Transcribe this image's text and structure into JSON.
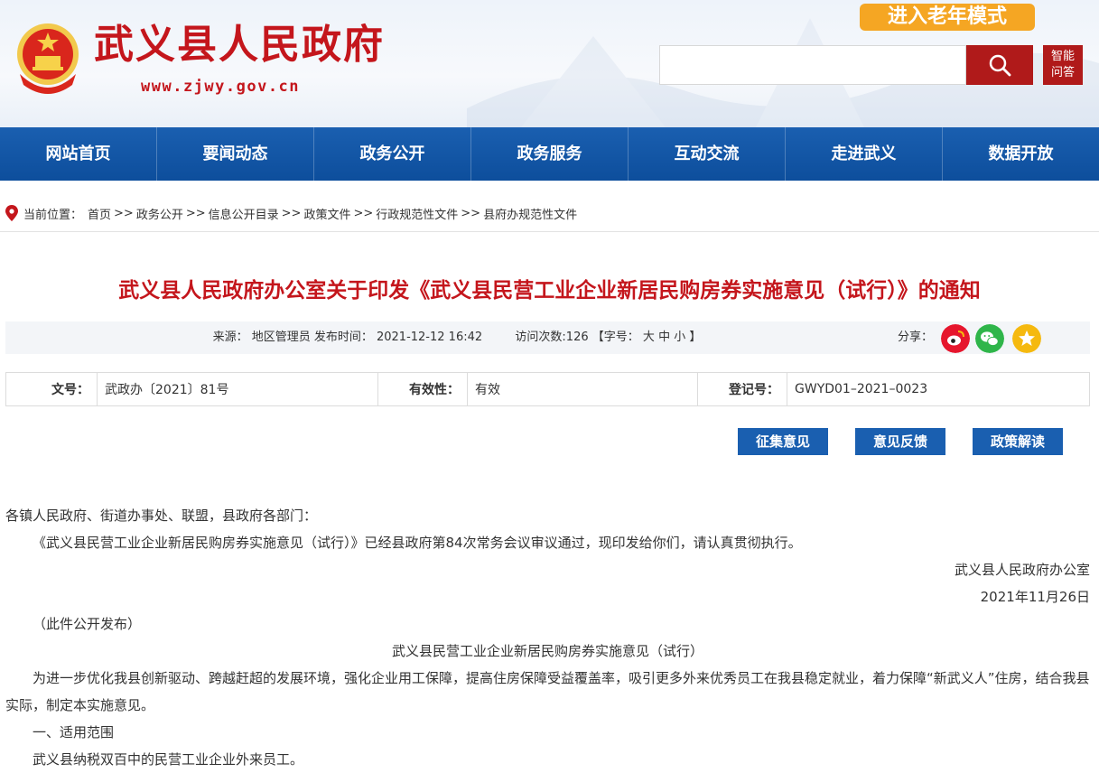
{
  "header": {
    "site_title": "武义县人民政府",
    "site_url": "www.zjwy.gov.cn",
    "elder_mode_label": "进入老年模式",
    "search_placeholder": "",
    "smart_qa_line1": "智能",
    "smart_qa_line2": "问答"
  },
  "nav": {
    "items": [
      "网站首页",
      "要闻动态",
      "政务公开",
      "政务服务",
      "互动交流",
      "走进武义",
      "数据开放"
    ]
  },
  "breadcrumb": {
    "label": "当前位置：",
    "items": [
      "首页",
      "政务公开",
      "信息公开目录",
      "政策文件",
      "行政规范性文件",
      "县府办规范性文件"
    ],
    "separator": ">>"
  },
  "article": {
    "title": "武义县人民政府办公室关于印发《武义县民营工业企业新居民购房券实施意见（试行）》的通知",
    "meta": {
      "source": "来源： 地区管理员",
      "publish_time": "发布时间： 2021-12-12 16:42",
      "visits": "访问次数:126",
      "font_size_label": "【字号：",
      "font_large": "大",
      "font_medium": "中",
      "font_small": "小",
      "font_size_end": "】",
      "share_label": "分享："
    },
    "info_table": {
      "doc_no_label": "文号：",
      "doc_no_value": "武政办〔2021〕81号",
      "validity_label": "有效性：",
      "validity_value": "有效",
      "reg_no_label": "登记号：",
      "reg_no_value": "GWYD01–2021–0023"
    },
    "actions": {
      "collect_opinion": "征集意见",
      "feedback": "意见反馈",
      "interpretation": "政策解读"
    },
    "body": {
      "salutation": "各镇人民政府、街道办事处、联盟，县政府各部门：",
      "p1": "《武义县民营工业企业新居民购房券实施意见（试行）》已经县政府第84次常务会议审议通过，现印发给你们，请认真贯彻执行。",
      "signature": "武义县人民政府办公室",
      "date": "2021年11月26日",
      "public_note": "（此件公开发布）",
      "subtitle": "武义县民营工业企业新居民购房券实施意见（试行）",
      "p2": "为进一步优化我县创新驱动、跨越赶超的发展环境，强化企业用工保障，提高住房保障受益覆盖率，吸引更多外来优秀员工在我县稳定就业，着力保障“新武义人”住房，结合我县实际，制定本实施意见。",
      "section1": "一、适用范围",
      "p3": "武义县纳税双百中的民营工业企业外来员工。"
    }
  },
  "colors": {
    "brand_red": "#c4161c",
    "nav_blue": "#1a5fb0",
    "elder_orange": "#f5a623",
    "weibo_red": "#e6162d",
    "wechat_green": "#2fb54a",
    "favorite_yellow": "#f5b90f"
  },
  "icons": {
    "emblem": "national-emblem-icon",
    "search": "search-icon",
    "location": "location-pin-icon",
    "weibo": "weibo-icon",
    "wechat": "wechat-icon",
    "favorite": "star-icon"
  }
}
